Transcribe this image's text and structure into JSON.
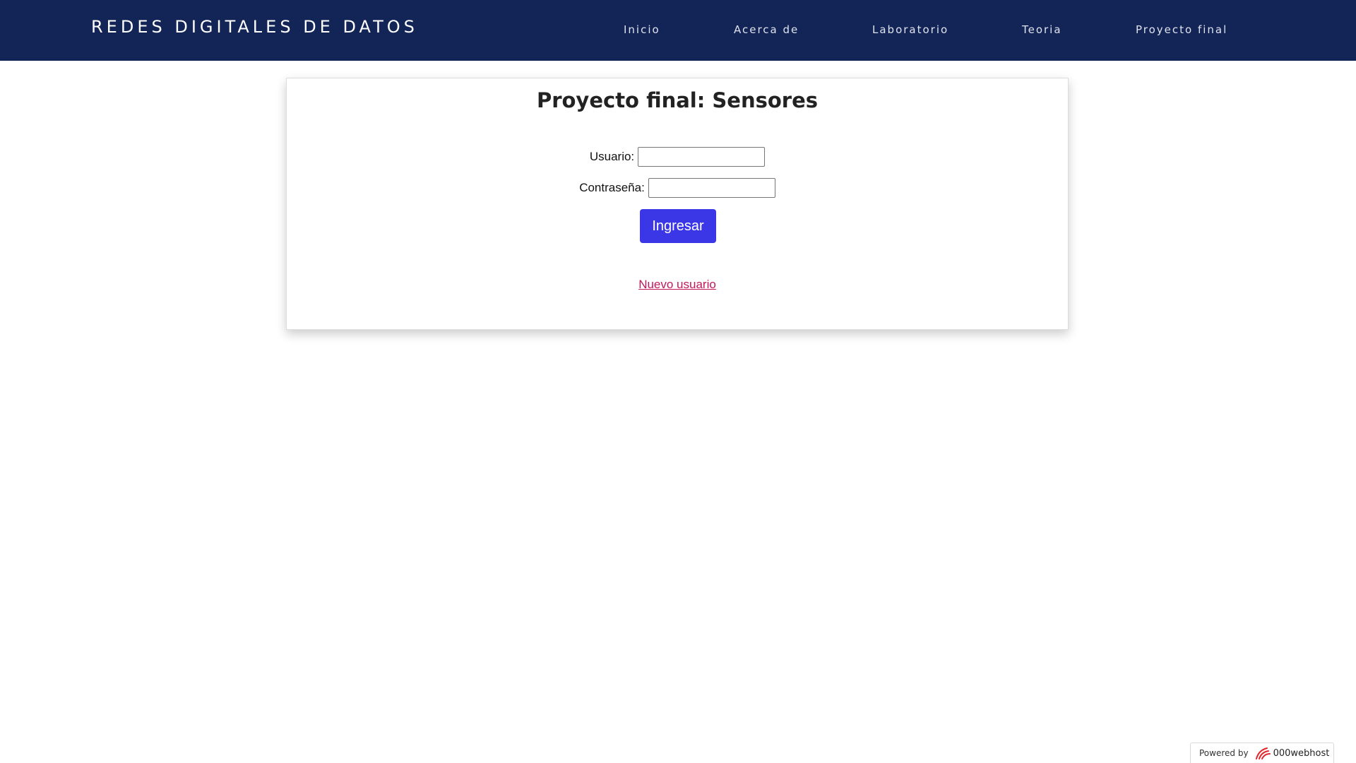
{
  "header": {
    "brand": "REDES DIGITALES DE DATOS",
    "nav": [
      {
        "label": "Inicio"
      },
      {
        "label": "Acerca de"
      },
      {
        "label": "Laboratorio"
      },
      {
        "label": "Teoria"
      },
      {
        "label": "Proyecto final"
      }
    ]
  },
  "login": {
    "title": "Proyecto final: Sensores",
    "username_label": "Usuario:",
    "username_value": "",
    "password_label": "Contraseña:",
    "password_value": "",
    "submit_label": "Ingresar",
    "new_user_link": "Nuevo usuario"
  },
  "footer_badge": {
    "powered_by": "Powered by",
    "host_name": "000webhost",
    "logo_icon": "000webhost-logo-icon"
  },
  "colors": {
    "navbar_bg": "#132457",
    "button_bg": "#3b37e6",
    "link": "#c2185b",
    "logo": "#e3262c"
  }
}
